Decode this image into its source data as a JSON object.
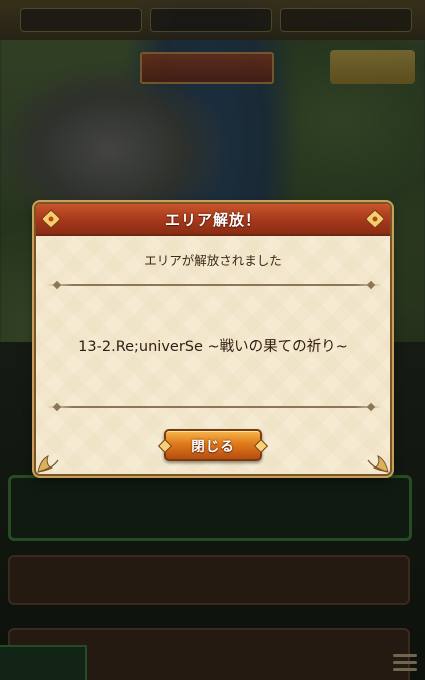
{
  "dialog": {
    "title": "エリア解放！",
    "message": "エリアが解放されました",
    "area_name": "13-2.Re;univerSe ~戦いの果ての祈り~",
    "close_label": "閉じる"
  },
  "colors": {
    "header": "#a4381b",
    "panel": "#f5ebd3",
    "button": "#e07b1d",
    "border": "#7a5328"
  },
  "icons": [
    "menu-icon",
    "corner-ornament-icon"
  ]
}
